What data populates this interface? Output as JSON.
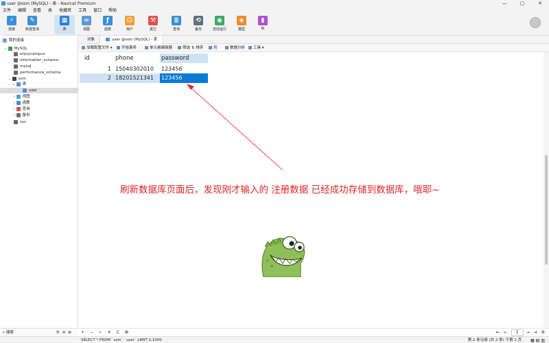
{
  "window": {
    "title": "user @ssm (MySQL) - 表 - Navicat Premium",
    "controls": [
      "—",
      "▢",
      "✕"
    ]
  },
  "menu": [
    "文件",
    "编辑",
    "查看",
    "表",
    "收藏夹",
    "工具",
    "窗口",
    "帮助"
  ],
  "toolbar": {
    "buttons": [
      {
        "label": "连接",
        "icon": "connect-icon",
        "color": "#3a8fd6"
      },
      {
        "label": "新建查询",
        "icon": "new-query-icon",
        "color": "#3a8fd6"
      },
      {
        "label": "表",
        "icon": "table-icon",
        "color": "#2f7fd0"
      },
      {
        "label": "视图",
        "icon": "view-icon",
        "color": "#5a9bd5"
      },
      {
        "label": "函数",
        "icon": "function-icon",
        "color": "#3a8fd6"
      },
      {
        "label": "用户",
        "icon": "user-icon",
        "color": "#f0a030"
      },
      {
        "label": "其它",
        "icon": "tools-icon",
        "color": "#e05050"
      },
      {
        "label": "查询",
        "icon": "query-icon",
        "color": "#3a8fd6"
      },
      {
        "label": "备份",
        "icon": "backup-icon",
        "color": "#607080"
      },
      {
        "label": "自动运行",
        "icon": "robot-icon",
        "color": "#3aa86a"
      },
      {
        "label": "模型",
        "icon": "model-icon",
        "color": "#f08a30"
      },
      {
        "label": "BI",
        "icon": "bi-icon",
        "color": "#b050d0"
      }
    ]
  },
  "sidebar": {
    "header": "我的连接",
    "items": [
      {
        "label": "MySQL",
        "icon": "mysql-connection-icon"
      },
      {
        "label": "enjoycampus",
        "icon": "database-icon"
      },
      {
        "label": "information_schema",
        "icon": "database-icon"
      },
      {
        "label": "mysql",
        "icon": "database-icon"
      },
      {
        "label": "performance_schema",
        "icon": "database-icon"
      },
      {
        "label": "ssm",
        "icon": "database-icon"
      },
      {
        "label": "表",
        "icon": "tables-folder-icon"
      },
      {
        "label": "user",
        "icon": "table-icon"
      },
      {
        "label": "视图",
        "icon": "views-folder-icon"
      },
      {
        "label": "函数",
        "icon": "functions-folder-icon"
      },
      {
        "label": "查询",
        "icon": "queries-folder-icon"
      },
      {
        "label": "备份",
        "icon": "backups-folder-icon"
      },
      {
        "label": "sys",
        "icon": "database-icon"
      }
    ],
    "search_placeholder": "搜索"
  },
  "tabs": [
    "对象",
    "user @ssm (MySQL) - 表"
  ],
  "data_toolbar": [
    "加载配置文件 ▾",
    "开始事务",
    "单元格编辑器",
    "筛选 ⇅ 排序",
    "列",
    "数据分析",
    "工具 ▾"
  ],
  "table": {
    "columns": [
      "id",
      "phone",
      "password"
    ],
    "rows": [
      [
        "1",
        "15040302010",
        "123456"
      ],
      [
        "2",
        "18201521341",
        "123456"
      ]
    ]
  },
  "annotation": {
    "text": "刷新数据库页面后，发现刚才输入的 注册数据 已经成功存储到数据库，哦耶~",
    "color": "#e0262a"
  },
  "bottom_nav": {
    "left_controls": "+ − ✓ ✕ C ⊞",
    "page": "1"
  },
  "status": {
    "sql": "SELECT * FROM `ssm`.`user` LIMIT 0,1000",
    "info": "第 2 条记录 (共 2 条) 于第 1 页"
  }
}
